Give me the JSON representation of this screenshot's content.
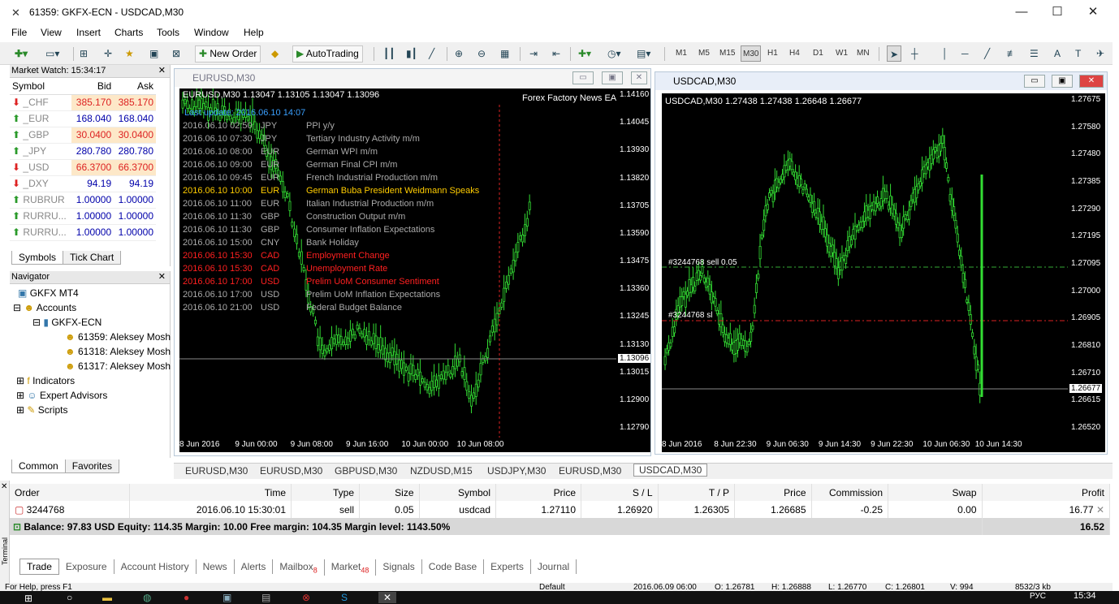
{
  "window": {
    "title": "61359: GKFX-ECN - USDCAD,M30"
  },
  "menu": [
    "File",
    "View",
    "Insert",
    "Charts",
    "Tools",
    "Window",
    "Help"
  ],
  "toolbar": {
    "new_order": "New Order",
    "autotrading": "AutoTrading",
    "timeframes": [
      "M1",
      "M5",
      "M15",
      "M30",
      "H1",
      "H4",
      "D1",
      "W1",
      "MN"
    ]
  },
  "market_watch": {
    "title": "Market Watch: 15:34:17",
    "cols": [
      "Symbol",
      "Bid",
      "Ask"
    ],
    "rows": [
      {
        "dir": "down",
        "sym": "_CHF",
        "bid": "385.170",
        "ask": "385.170",
        "hl": true
      },
      {
        "dir": "up",
        "sym": "_EUR",
        "bid": "168.040",
        "ask": "168.040",
        "hl": false
      },
      {
        "dir": "up",
        "sym": "_GBP",
        "bid": "30.0400",
        "ask": "30.0400",
        "hl": true
      },
      {
        "dir": "up",
        "sym": "_JPY",
        "bid": "280.780",
        "ask": "280.780",
        "hl": false
      },
      {
        "dir": "down",
        "sym": "_USD",
        "bid": "66.3700",
        "ask": "66.3700",
        "hl": true
      },
      {
        "dir": "down",
        "sym": "_DXY",
        "bid": "94.19",
        "ask": "94.19",
        "hl": false
      },
      {
        "dir": "up",
        "sym": "RUBRUR",
        "bid": "1.00000",
        "ask": "1.00000",
        "hl": false
      },
      {
        "dir": "up",
        "sym": "RURRU...",
        "bid": "1.00000",
        "ask": "1.00000",
        "hl": false
      },
      {
        "dir": "up",
        "sym": "RURRU...",
        "bid": "1.00000",
        "ask": "1.00000",
        "hl": false
      }
    ],
    "tabs": [
      "Symbols",
      "Tick Chart"
    ]
  },
  "navigator": {
    "title": "Navigator",
    "root": "GKFX MT4",
    "accounts": "Accounts",
    "server": "GKFX-ECN",
    "acc": [
      "61359: Aleksey Mosh",
      "61318: Aleksey Mosh",
      "61317: Aleksey Mosh"
    ],
    "indicators": "Indicators",
    "experts": "Expert Advisors",
    "scripts": "Scripts",
    "tabs": [
      "Common",
      "Favorites"
    ]
  },
  "eurusd": {
    "caption": "EURUSD,M30",
    "header": "EURUSD,M30  1.13047 1.13105 1.13047 1.13096",
    "ea": "Forex Factory News EA",
    "last_update": "Last update: 2016.06.10 14:07",
    "news": [
      [
        "2016.06.10 02:50",
        "JPY",
        "PPI y/y",
        "#aaa"
      ],
      [
        "2016.06.10 07:30",
        "JPY",
        "Tertiary Industry Activity m/m",
        "#aaa"
      ],
      [
        "2016.06.10 08:00",
        "EUR",
        "German WPI m/m",
        "#aaa"
      ],
      [
        "2016.06.10 09:00",
        "EUR",
        "German Final CPI m/m",
        "#aaa"
      ],
      [
        "2016.06.10 09:45",
        "EUR",
        "French Industrial Production m/m",
        "#aaa"
      ],
      [
        "2016.06.10 10:00",
        "EUR",
        "German Buba President Weidmann Speaks",
        "#ffcc00"
      ],
      [
        "2016.06.10 11:00",
        "EUR",
        "Italian Industrial Production m/m",
        "#aaa"
      ],
      [
        "2016.06.10 11:30",
        "GBP",
        "Construction Output m/m",
        "#aaa"
      ],
      [
        "2016.06.10 11:30",
        "GBP",
        "Consumer Inflation Expectations",
        "#aaa"
      ],
      [
        "2016.06.10 15:00",
        "CNY",
        "Bank Holiday",
        "#aaa"
      ],
      [
        "2016.06.10 15:30",
        "CAD",
        "Employment Change",
        "#ff2020"
      ],
      [
        "2016.06.10 15:30",
        "CAD",
        "Unemployment Rate",
        "#ff2020"
      ],
      [
        "2016.06.10 17:00",
        "USD",
        "Prelim UoM Consumer Sentiment",
        "#ff2020"
      ],
      [
        "2016.06.10 17:00",
        "USD",
        "Prelim UoM Inflation Expectations",
        "#aaa"
      ],
      [
        "2016.06.10 21:00",
        "USD",
        "Federal Budget Balance",
        "#aaa"
      ]
    ],
    "yticks": [
      "1.14160",
      "1.14045",
      "1.13930",
      "1.13820",
      "1.13705",
      "1.13590",
      "1.13475",
      "1.13360",
      "1.13245",
      "1.13130",
      "1.13015",
      "1.12900",
      "1.12790"
    ],
    "price": "1.13096",
    "xticks": [
      "8 Jun 2016",
      "9 Jun 00:00",
      "9 Jun 08:00",
      "9 Jun 16:00",
      "10 Jun 00:00",
      "10 Jun 08:00"
    ]
  },
  "usdcad": {
    "caption": "USDCAD,M30",
    "header": "USDCAD,M30  1.27438 1.27438 1.26648 1.26677",
    "order_label": "#3244768 sell 0.05",
    "sl_label": "#3244768 sl",
    "yticks": [
      "1.27675",
      "1.27580",
      "1.27480",
      "1.27385",
      "1.27290",
      "1.27195",
      "1.27095",
      "1.27000",
      "1.26905",
      "1.26810",
      "1.26710",
      "1.26615",
      "1.26520"
    ],
    "price": "1.26677",
    "xticks": [
      "8 Jun 2016",
      "8 Jun 22:30",
      "9 Jun 06:30",
      "9 Jun 14:30",
      "9 Jun 22:30",
      "10 Jun 06:30",
      "10 Jun 14:30"
    ]
  },
  "chart_tabs": [
    "EURUSD,M30",
    "EURUSD,M30",
    "GBPUSD,M30",
    "NZDUSD,M15",
    "USDJPY,M30",
    "EURUSD,M30",
    "USDCAD,M30"
  ],
  "terminal": {
    "cols": [
      "Order",
      "Time",
      "Type",
      "Size",
      "Symbol",
      "Price",
      "S / L",
      "T / P",
      "Price",
      "Commission",
      "Swap",
      "Profit"
    ],
    "row": [
      "3244768",
      "2016.06.10 15:30:01",
      "sell",
      "0.05",
      "usdcad",
      "1.27110",
      "1.26920",
      "1.26305",
      "1.26685",
      "-0.25",
      "0.00",
      "16.77"
    ],
    "balance": "Balance: 97.83 USD  Equity: 114.35  Margin: 10.00  Free margin: 104.35  Margin level: 1143.50%",
    "total": "16.52",
    "side_label": "Terminal",
    "tabs": [
      "Trade",
      "Exposure",
      "Account History",
      "News",
      "Alerts",
      "Mailbox",
      "Market",
      "Signals",
      "Code Base",
      "Experts",
      "Journal"
    ],
    "mailbox_count": "8",
    "market_count": "48"
  },
  "status": {
    "help": "For Help, press F1",
    "profile": "Default",
    "time": "2016.06.09 06:00",
    "open": "O: 1.26781",
    "high": "H: 1.26888",
    "low": "L: 1.26770",
    "close": "C: 1.26801",
    "vol": "V: 994",
    "traffic": "8532/3 kb"
  },
  "taskbar": {
    "clock": "15:34",
    "lang": "РУС"
  }
}
